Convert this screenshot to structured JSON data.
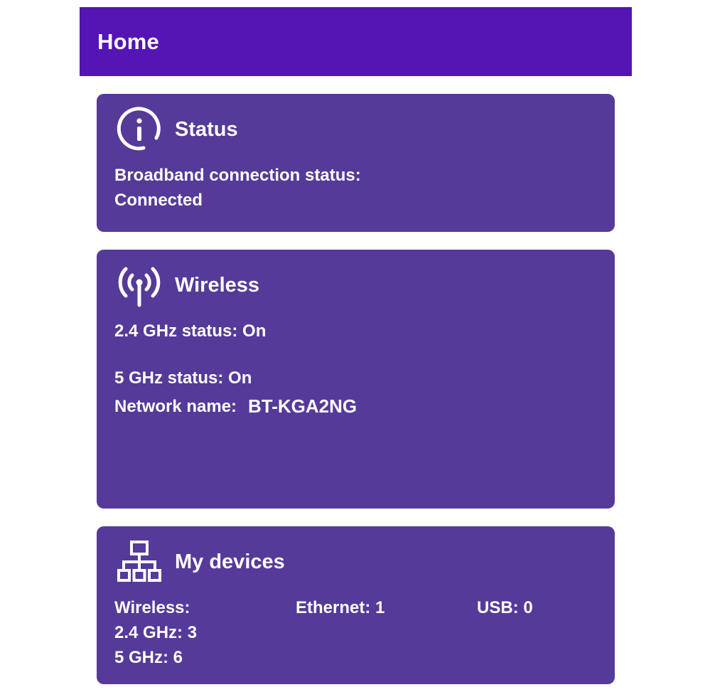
{
  "header": {
    "title": "Home"
  },
  "status_card": {
    "title": "Status",
    "icon": "info-icon",
    "broadband_label": "Broadband connection status:",
    "broadband_value": "Connected"
  },
  "wireless_card": {
    "title": "Wireless",
    "icon": "antenna-icon",
    "band_24_status": "2.4 GHz status: On",
    "band_5_status": "5 GHz status: On",
    "network_name_label": "Network name:",
    "network_name_value": "BT-KGA2NG"
  },
  "devices_card": {
    "title": "My devices",
    "icon": "network-devices-icon",
    "wireless_label": "Wireless:",
    "wireless_24": "2.4 GHz: 3",
    "wireless_5": "5 GHz: 6",
    "ethernet": "Ethernet: 1",
    "usb": "USB: 0"
  },
  "colors": {
    "header_bg": "#5514b4",
    "card_bg": "#553a99",
    "text": "#ffffff"
  }
}
